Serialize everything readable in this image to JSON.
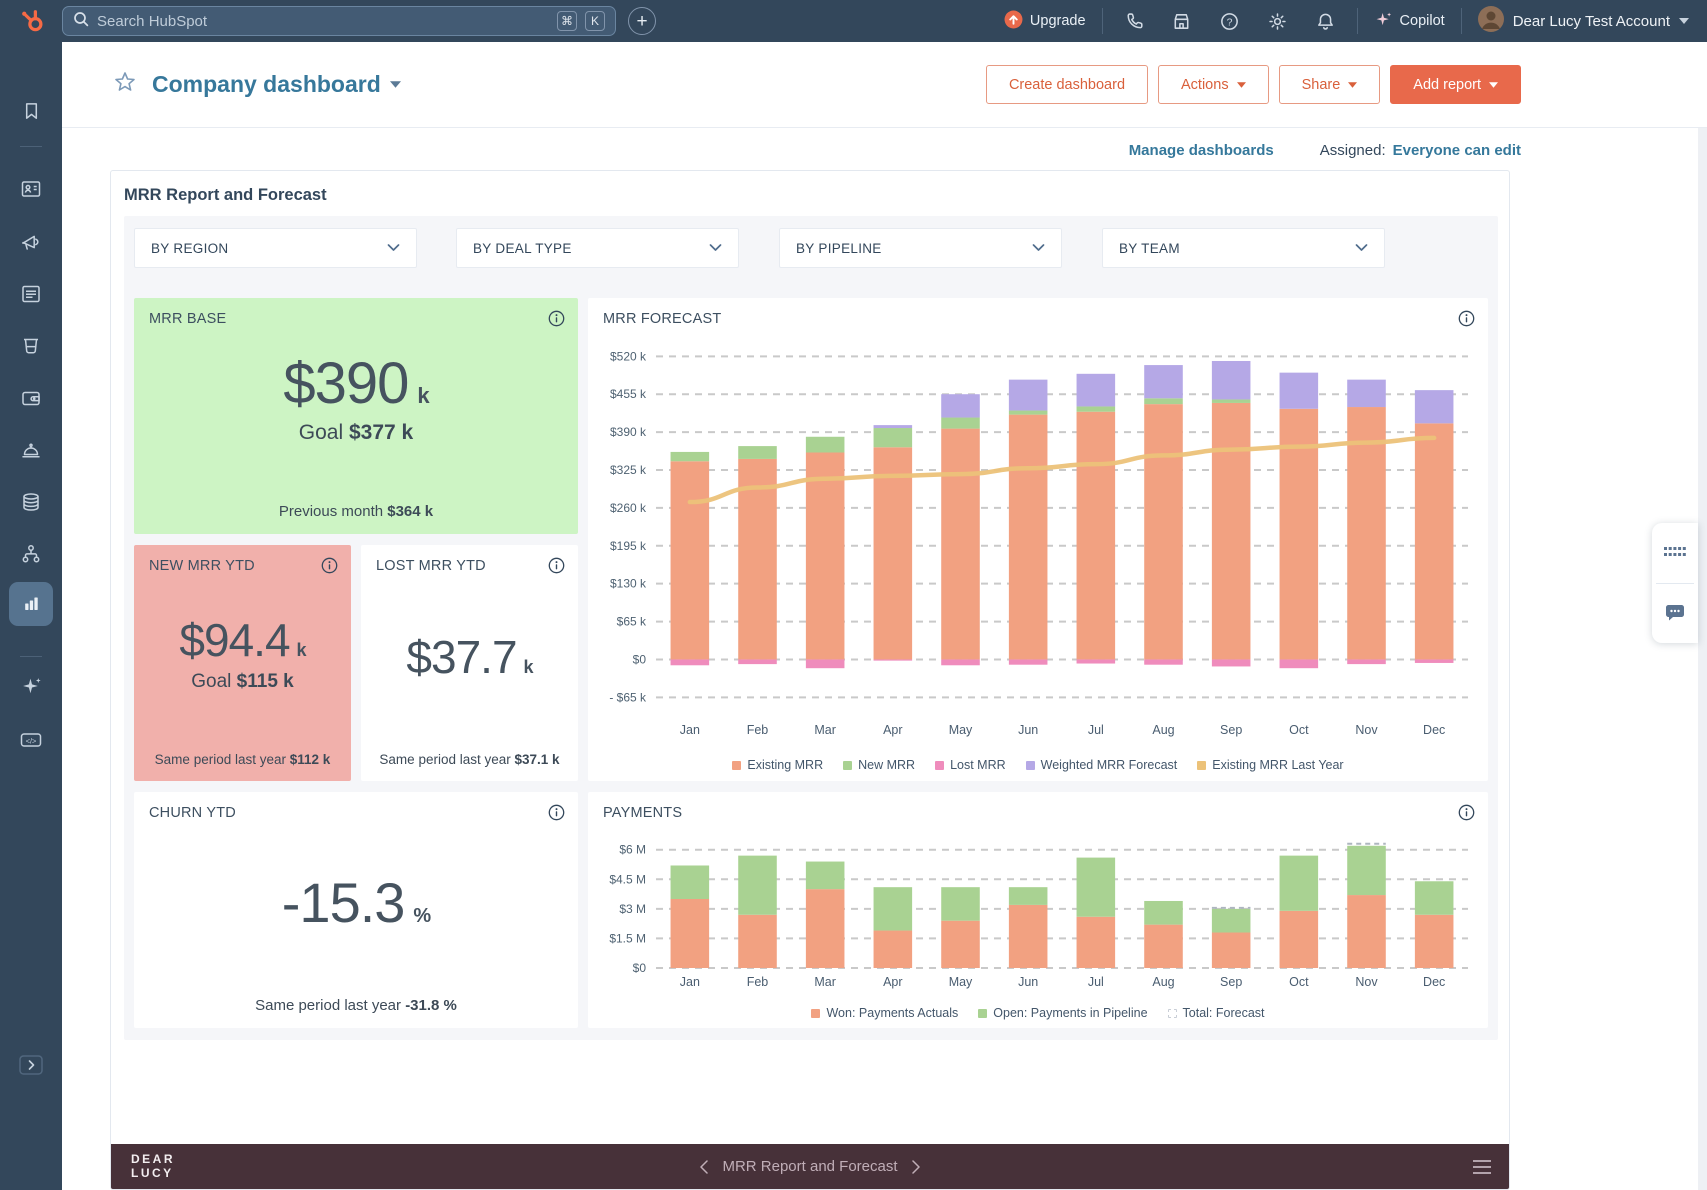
{
  "topbar": {
    "search": {
      "placeholder": "Search HubSpot",
      "keys": [
        "⌘",
        "K"
      ]
    },
    "upgrade_label": "Upgrade",
    "copilot_label": "Copilot",
    "account_name": "Dear Lucy Test Account"
  },
  "header": {
    "title": "Company dashboard",
    "create_btn": "Create dashboard",
    "actions_btn": "Actions",
    "share_btn": "Share",
    "add_report_btn": "Add report"
  },
  "subheader": {
    "manage_link": "Manage dashboards",
    "assigned_label": "Assigned:",
    "assigned_value": "Everyone can edit"
  },
  "dashboard": {
    "title": "MRR Report and Forecast",
    "filters": [
      {
        "label": "BY REGION"
      },
      {
        "label": "BY DEAL TYPE"
      },
      {
        "label": "BY PIPELINE"
      },
      {
        "label": "BY TEAM"
      }
    ],
    "kpis": {
      "mrr_base": {
        "label": "MRR BASE",
        "value": "$390",
        "unit": "k",
        "goal_label": "Goal",
        "goal_value": "$377 k",
        "footer_label": "Previous month",
        "footer_value": "$364 k",
        "bg": "#cdf4c4"
      },
      "new_mrr": {
        "label": "NEW MRR YTD",
        "value": "$94.4",
        "unit": "k",
        "goal_label": "Goal",
        "goal_value": "$115 k",
        "footer_label": "Same period last year",
        "footer_value": "$112 k",
        "bg": "#f1b0ab"
      },
      "lost_mrr": {
        "label": "LOST MRR YTD",
        "value": "$37.7",
        "unit": "k",
        "footer_label": "Same period last year",
        "footer_value": "$37.1 k",
        "bg": "#ffffff"
      },
      "churn": {
        "label": "CHURN YTD",
        "value": "-15.3",
        "unit": "%",
        "footer_label": "Same period last year",
        "footer_value": "-31.8 %",
        "bg": "#ffffff"
      }
    }
  },
  "chart_data": [
    {
      "type": "bar",
      "stacked": true,
      "title": "MRR FORECAST",
      "categories": [
        "Jan",
        "Feb",
        "Mar",
        "Apr",
        "May",
        "Jun",
        "Jul",
        "Aug",
        "Sep",
        "Oct",
        "Nov",
        "Dec"
      ],
      "series": [
        {
          "name": "Existing MRR",
          "color": "#f2a181",
          "values": [
            340,
            344,
            355,
            364,
            396,
            420,
            425,
            438,
            440,
            430,
            433,
            405
          ]
        },
        {
          "name": "New MRR",
          "color": "#a9d292",
          "values": [
            16,
            22,
            27,
            33,
            19,
            7,
            9,
            10,
            6,
            0,
            0,
            0
          ]
        },
        {
          "name": "Lost MRR",
          "color": "#ef8cbc",
          "values": [
            -10,
            -8,
            -15,
            -2,
            -10,
            -9,
            -7,
            -9,
            -12,
            -15,
            -8,
            -6
          ]
        },
        {
          "name": "Weighted MRR Forecast",
          "color": "#b5a8e6",
          "values": [
            0,
            0,
            0,
            5,
            40,
            53,
            56,
            57,
            66,
            62,
            47,
            57
          ]
        },
        {
          "name": "Existing MRR Last Year",
          "color": "#ecc279",
          "type": "line",
          "values": [
            270,
            295,
            310,
            315,
            318,
            328,
            335,
            350,
            360,
            365,
            372,
            380
          ]
        }
      ],
      "unit": "k",
      "ylim": [
        -97,
        548
      ],
      "yticks": [
        {
          "v": 520,
          "label": "$520 k"
        },
        {
          "v": 455,
          "label": "$455 k"
        },
        {
          "v": 390,
          "label": "$390 k"
        },
        {
          "v": 325,
          "label": "$325 k"
        },
        {
          "v": 260,
          "label": "$260 k"
        },
        {
          "v": 195,
          "label": "$195 k"
        },
        {
          "v": 130,
          "label": "$130 k"
        },
        {
          "v": 65,
          "label": "$65 k"
        },
        {
          "v": 0,
          "label": "$0"
        },
        {
          "v": -65,
          "label": "- $65 k"
        }
      ],
      "legend": [
        {
          "label": "Existing MRR",
          "color": "#f2a181"
        },
        {
          "label": "New MRR",
          "color": "#a9d292"
        },
        {
          "label": "Lost MRR",
          "color": "#ef8cbc"
        },
        {
          "label": "Weighted MRR Forecast",
          "color": "#b5a8e6"
        },
        {
          "label": "Existing MRR Last Year",
          "color": "#ecc279"
        }
      ],
      "grid": "dashed",
      "legend_position": "bottom"
    },
    {
      "type": "bar",
      "stacked": true,
      "title": "PAYMENTS",
      "categories": [
        "Jan",
        "Feb",
        "Mar",
        "Apr",
        "May",
        "Jun",
        "Jul",
        "Aug",
        "Sep",
        "Oct",
        "Nov",
        "Dec"
      ],
      "series": [
        {
          "name": "Won: Payments Actuals",
          "color": "#f2a181",
          "values": [
            3.5,
            2.7,
            4.0,
            1.9,
            2.4,
            3.2,
            2.6,
            2.2,
            1.8,
            2.9,
            3.7,
            2.7
          ]
        },
        {
          "name": "Open: Payments in Pipeline",
          "color": "#a9d292",
          "values": [
            1.7,
            3.0,
            1.4,
            2.2,
            1.7,
            0.9,
            3.0,
            1.2,
            1.2,
            2.8,
            2.5,
            1.7
          ]
        }
      ],
      "forecast_caps": [
        null,
        null,
        null,
        null,
        null,
        null,
        null,
        null,
        3.05,
        null,
        6.3,
        null
      ],
      "unit": "M",
      "ylim": [
        0,
        7.0
      ],
      "yticks": [
        {
          "v": 6,
          "label": "$6 M"
        },
        {
          "v": 4.5,
          "label": "$4.5 M"
        },
        {
          "v": 3,
          "label": "$3 M"
        },
        {
          "v": 1.5,
          "label": "$1.5 M"
        },
        {
          "v": 0,
          "label": "$0"
        }
      ],
      "legend": [
        {
          "label": "Won: Payments Actuals",
          "color": "#f2a181"
        },
        {
          "label": "Open: Payments in Pipeline",
          "color": "#a9d292"
        },
        {
          "label": "Total: Forecast",
          "color": "none"
        }
      ],
      "grid": "dashed",
      "legend_position": "bottom"
    }
  ],
  "footer": {
    "brand_line1": "DEAR",
    "brand_line2": "LUCY",
    "nav_title": "MRR Report and Forecast"
  },
  "colors": {
    "navy": "#33475b",
    "accent_orange": "#e8694b",
    "link_teal": "#35789b",
    "kpi_green": "#cdf4c4",
    "kpi_pink": "#f1b0ab",
    "footer_plum": "#473139"
  }
}
